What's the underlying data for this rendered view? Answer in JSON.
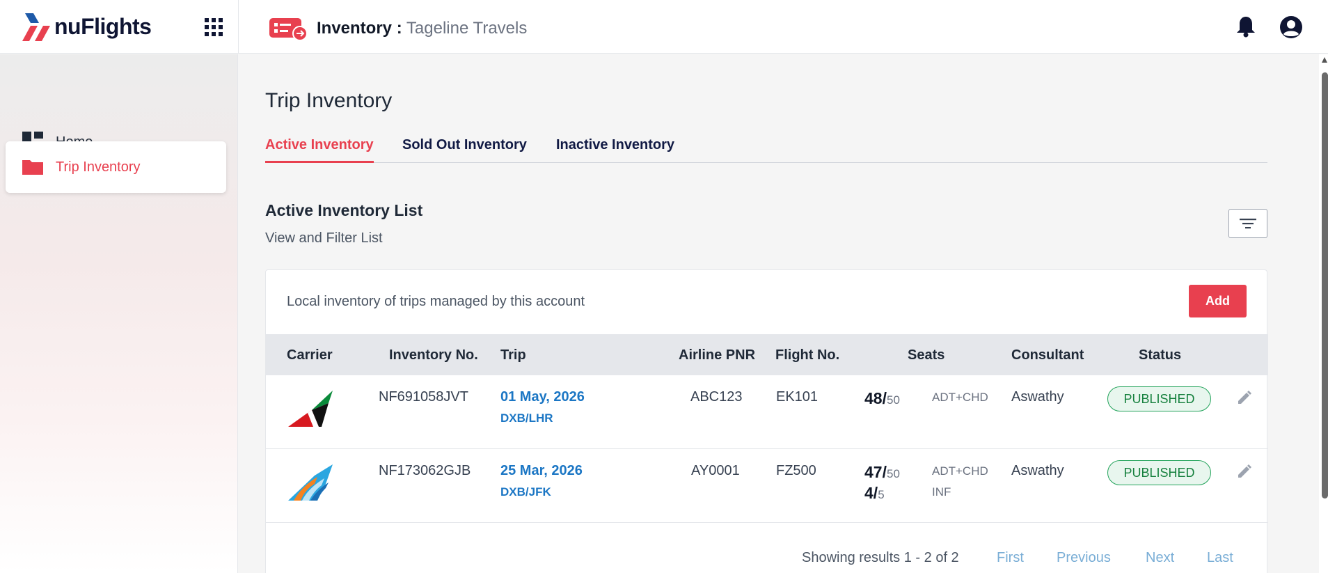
{
  "brand": {
    "name": "nuFlights"
  },
  "header": {
    "title": "Inventory :",
    "account": "Tageline Travels"
  },
  "sidebar": {
    "items": [
      {
        "label": "Home",
        "icon": "dashboard-icon"
      },
      {
        "label": "Trip Inventory",
        "icon": "folder-icon",
        "active": true
      }
    ]
  },
  "main": {
    "title": "Trip Inventory",
    "tabs": [
      {
        "label": "Active Inventory",
        "active": true
      },
      {
        "label": "Sold Out Inventory"
      },
      {
        "label": "Inactive Inventory"
      }
    ],
    "list_title": "Active Inventory List",
    "list_subtitle": "View and Filter List",
    "card_description": "Local inventory of trips managed by this account",
    "add_label": "Add",
    "columns": [
      "Carrier",
      "Inventory No.",
      "Trip",
      "Airline PNR",
      "Flight No.",
      "Seats",
      "Consultant",
      "Status"
    ],
    "rows": [
      {
        "carrier_logo": "emirates-logo",
        "inventory_no": "NF691058JVT",
        "trip_date": "01 May, 2026",
        "trip_route": "DXB/LHR",
        "pnr": "ABC123",
        "flight_no": "EK101",
        "seats": [
          {
            "available": "48/",
            "total": "50",
            "type": "ADT+CHD"
          }
        ],
        "consultant": "Aswathy",
        "status": "PUBLISHED"
      },
      {
        "carrier_logo": "flydubai-logo",
        "inventory_no": "NF173062GJB",
        "trip_date": "25 Mar, 2026",
        "trip_route": "DXB/JFK",
        "pnr": "AY0001",
        "flight_no": "FZ500",
        "seats": [
          {
            "available": "47/",
            "total": "50",
            "type": "ADT+CHD"
          },
          {
            "available": "4/",
            "total": "5",
            "type": "INF"
          }
        ],
        "consultant": "Aswathy",
        "status": "PUBLISHED"
      }
    ],
    "pagination": {
      "info": "Showing results 1 - 2 of 2",
      "first": "First",
      "previous": "Previous",
      "next": "Next",
      "last": "Last"
    }
  },
  "colors": {
    "accent": "#e8404f",
    "link": "#1b76c4",
    "status_green": "#15803d",
    "pager_link": "#7aaed6",
    "brand_navy": "#0f1533"
  }
}
